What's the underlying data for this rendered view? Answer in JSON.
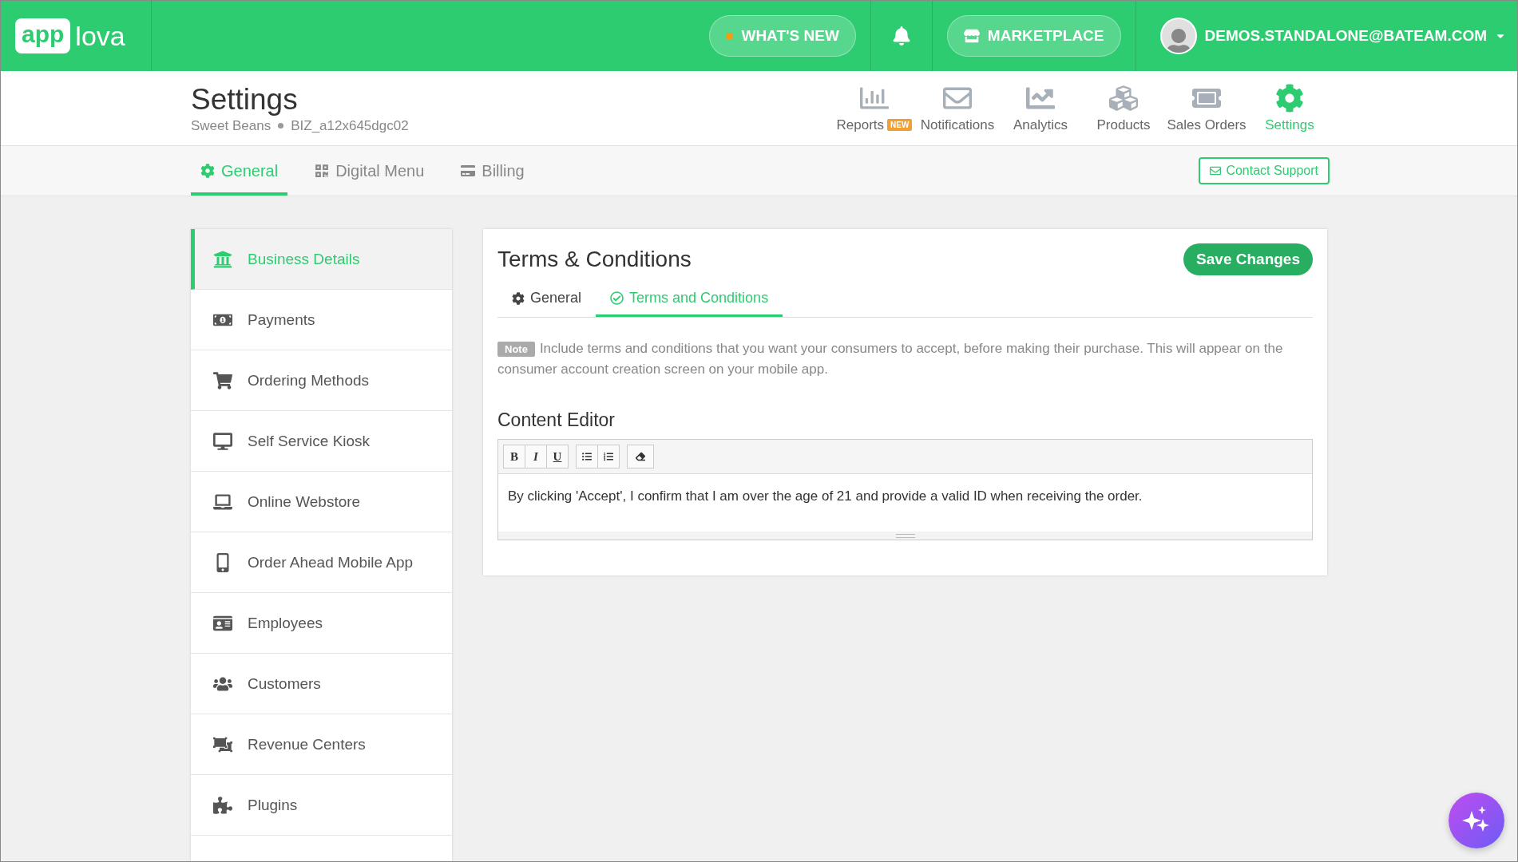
{
  "topbar": {
    "logo": {
      "badge_text": "app",
      "text": "lova"
    },
    "whats_new": "WHAT'S NEW",
    "marketplace": "MARKETPLACE",
    "user_email": "DEMOS.STANDALONE@BATEAM.COM"
  },
  "header": {
    "title": "Settings",
    "business_name": "Sweet Beans",
    "business_id": "BIZ_a12x645dgc02",
    "nav": [
      {
        "label": "Reports",
        "badge": "NEW",
        "selected": false
      },
      {
        "label": "Notifications",
        "selected": false
      },
      {
        "label": "Analytics",
        "selected": false
      },
      {
        "label": "Products",
        "selected": false
      },
      {
        "label": "Sales Orders",
        "selected": false
      },
      {
        "label": "Settings",
        "selected": true
      }
    ]
  },
  "tabs": [
    {
      "label": "General",
      "selected": true
    },
    {
      "label": "Digital Menu",
      "selected": false
    },
    {
      "label": "Billing",
      "selected": false
    }
  ],
  "contact_support": "Contact Support",
  "sidebar": {
    "items": [
      {
        "label": "Business Details",
        "selected": true
      },
      {
        "label": "Payments",
        "selected": false
      },
      {
        "label": "Ordering Methods",
        "selected": false
      },
      {
        "label": "Self Service Kiosk",
        "selected": false
      },
      {
        "label": "Online Webstore",
        "selected": false
      },
      {
        "label": "Order Ahead Mobile App",
        "selected": false
      },
      {
        "label": "Employees",
        "selected": false
      },
      {
        "label": "Customers",
        "selected": false
      },
      {
        "label": "Revenue Centers",
        "selected": false
      },
      {
        "label": "Plugins",
        "selected": false
      }
    ]
  },
  "card": {
    "title": "Terms & Conditions",
    "save_button": "Save Changes",
    "tabs": [
      {
        "label": "General",
        "selected": false
      },
      {
        "label": "Terms and Conditions",
        "selected": true
      }
    ],
    "note": {
      "badge": "Note",
      "text": "Include terms and conditions that you want your consumers to accept, before making their purchase. This will appear on the consumer account creation screen on your mobile app."
    },
    "editor": {
      "heading": "Content Editor",
      "toolbar": [
        {
          "buttons": [
            {
              "kind": "bold",
              "label": "B"
            },
            {
              "kind": "italic",
              "label": "I"
            },
            {
              "kind": "underline",
              "label": "U"
            }
          ]
        },
        {
          "buttons": [
            {
              "kind": "bullet-list"
            },
            {
              "kind": "numbered-list"
            }
          ]
        },
        {
          "buttons": [
            {
              "kind": "eraser"
            }
          ]
        }
      ],
      "content": "By clicking 'Accept', I confirm that I am over the age of 21 and provide a valid ID when receiving the order."
    }
  }
}
